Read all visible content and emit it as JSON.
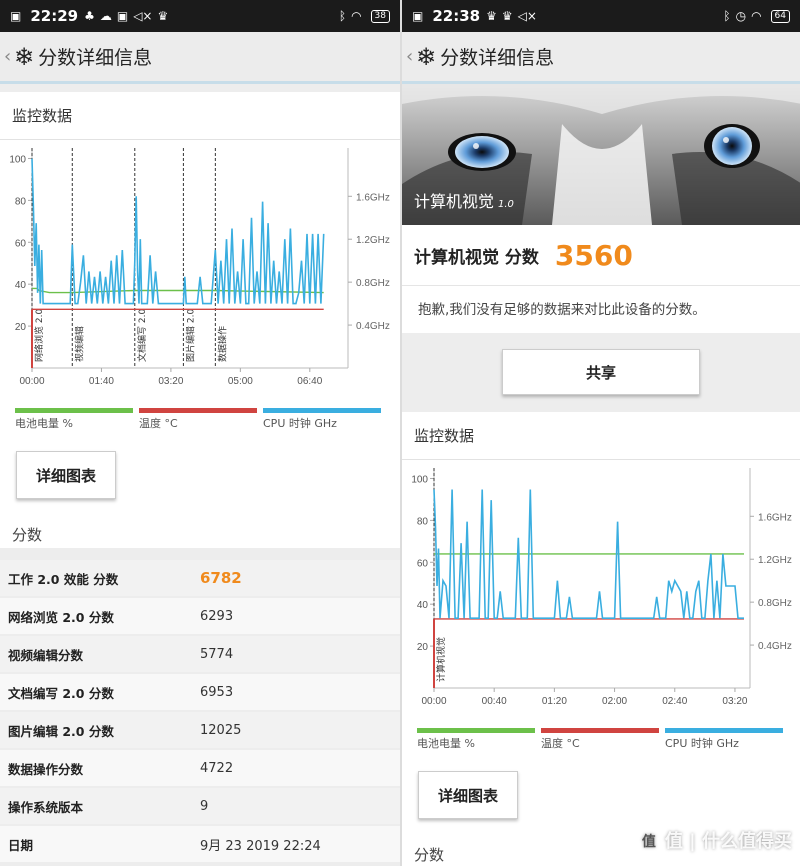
{
  "left": {
    "status": {
      "time": "22:29",
      "icons": [
        "image-icon",
        "penguin-icon",
        "cloud-icon",
        "mute-icon",
        "crown-icon"
      ],
      "battery": "38"
    },
    "header": {
      "title": "分数详细信息",
      "back": "‹",
      "logo": "❄"
    },
    "monitor": {
      "title": "监控数据"
    },
    "chart_labels": {
      "markers": [
        "网络浏览 2.0",
        "视频编辑",
        "文档编写 2.0",
        "图片编辑 2.0",
        "数据操作"
      ]
    },
    "legend": [
      {
        "label": "电池电量 %",
        "color": "#6cc04a"
      },
      {
        "label": "温度 °C",
        "color": "#d04440"
      },
      {
        "label": "CPU 时钟 GHz",
        "color": "#3aaee0"
      }
    ],
    "detail_button": "详细图表",
    "scores_title": "分数",
    "scores": [
      {
        "name": "工作 2.0 效能 分数",
        "value": "6782"
      },
      {
        "name": "网络浏览 2.0 分数",
        "value": "6293"
      },
      {
        "name": "视频编辑分数",
        "value": "5774"
      },
      {
        "name": "文档编写 2.0 分数",
        "value": "6953"
      },
      {
        "name": "图片编辑 2.0 分数",
        "value": "12025"
      },
      {
        "name": "数据操作分数",
        "value": "4722"
      },
      {
        "name": "操作系统版本",
        "value": "9"
      },
      {
        "name": "日期",
        "value": "9月 23 2019 22:24"
      }
    ]
  },
  "right": {
    "status": {
      "time": "22:38",
      "icons": [
        "image-icon",
        "crown-icon",
        "crown-icon",
        "mute-icon"
      ],
      "battery": "64"
    },
    "header": {
      "title": "分数详细信息",
      "back": "‹",
      "logo": "❄"
    },
    "hero": {
      "caption": "计算机视觉",
      "version": "1.0"
    },
    "score": {
      "label": "计算机视觉 分数",
      "value": "3560"
    },
    "notice": "抱歉,我们没有足够的数据来对比此设备的分数。",
    "share_button": "共享",
    "monitor": {
      "title": "监控数据"
    },
    "chart_labels": {
      "markers": [
        "计算机视觉"
      ]
    },
    "legend": [
      {
        "label": "电池电量 %",
        "color": "#6cc04a"
      },
      {
        "label": "温度 °C",
        "color": "#d04440"
      },
      {
        "label": "CPU 时钟 GHz",
        "color": "#3aaee0"
      }
    ],
    "detail_button": "详细图表",
    "scores_title": "分数"
  },
  "watermark": "值 | 什么值得买",
  "chart_data": [
    {
      "type": "line",
      "xlabel": "",
      "ylabel": "",
      "x_ticks": [
        "00:00",
        "01:40",
        "03:20",
        "05:00",
        "06:40"
      ],
      "x_range_minutes": [
        0,
        455
      ],
      "y_ticks_left": [
        20,
        40,
        60,
        80,
        100
      ],
      "ylim_left": [
        0,
        105
      ],
      "y_ticks_right": [
        "0.4GHz",
        "0.8GHz",
        "1.2GHz",
        "1.6GHz"
      ],
      "ylim_right_ghz": [
        0,
        2.05
      ],
      "markers_minutes": [
        0,
        58,
        148,
        218,
        264
      ],
      "series": [
        {
          "name": "电池电量 %",
          "color": "#6cc04a",
          "x": [
            0,
            8,
            10,
            25,
            58,
            148,
            150,
            218,
            264,
            420
          ],
          "y": [
            38,
            38,
            37,
            36,
            36,
            37,
            37,
            37,
            37,
            36
          ]
        },
        {
          "name": "温度 °C",
          "color": "#d04440",
          "x": [
            0,
            420
          ],
          "y": [
            28,
            28
          ]
        },
        {
          "name": "CPU 时钟 GHz",
          "color": "#3aaee0",
          "x": [
            0,
            2,
            4,
            6,
            8,
            10,
            12,
            14,
            16,
            20,
            25,
            30,
            35,
            40,
            45,
            50,
            52,
            55,
            58,
            62,
            66,
            70,
            74,
            78,
            82,
            86,
            90,
            94,
            98,
            102,
            106,
            110,
            114,
            118,
            122,
            126,
            130,
            134,
            138,
            142,
            146,
            148,
            150,
            152,
            154,
            156,
            158,
            162,
            166,
            170,
            174,
            178,
            182,
            186,
            190,
            196,
            202,
            208,
            214,
            218,
            220,
            222,
            226,
            230,
            234,
            238,
            242,
            246,
            250,
            254,
            258,
            264,
            268,
            272,
            276,
            280,
            284,
            288,
            292,
            296,
            300,
            304,
            308,
            312,
            316,
            320,
            324,
            328,
            332,
            336,
            340,
            344,
            348,
            352,
            356,
            360,
            364,
            368,
            372,
            376,
            380,
            384,
            388,
            392,
            396,
            400,
            404,
            408,
            412,
            416,
            420
          ],
          "y": [
            1.95,
            1.5,
            0.95,
            1.35,
            0.7,
            1.15,
            0.6,
            1.1,
            0.6,
            0.6,
            0.6,
            0.6,
            0.6,
            0.6,
            0.6,
            0.6,
            0.6,
            0.6,
            1.15,
            0.6,
            0.6,
            0.8,
            1.05,
            0.6,
            0.9,
            0.6,
            0.85,
            0.6,
            0.9,
            0.6,
            0.85,
            0.6,
            1.0,
            0.6,
            1.05,
            0.6,
            1.1,
            0.6,
            0.6,
            0.6,
            0.6,
            1.0,
            1.6,
            0.9,
            0.6,
            1.2,
            0.6,
            0.6,
            0.6,
            1.05,
            0.6,
            0.9,
            0.6,
            0.6,
            0.6,
            0.6,
            0.6,
            0.6,
            0.6,
            0.6,
            0.85,
            0.6,
            0.6,
            0.6,
            0.6,
            0.6,
            0.85,
            0.6,
            0.6,
            0.6,
            0.6,
            1.1,
            0.6,
            1.0,
            0.6,
            1.2,
            0.6,
            1.3,
            0.6,
            0.9,
            0.6,
            1.2,
            0.6,
            0.6,
            1.4,
            0.6,
            0.9,
            0.6,
            1.55,
            0.6,
            1.35,
            0.6,
            1.0,
            0.6,
            0.9,
            0.6,
            1.2,
            0.6,
            1.3,
            0.6,
            0.6,
            0.7,
            1.0,
            0.6,
            1.25,
            0.6,
            1.25,
            0.6,
            1.25,
            0.6,
            1.25
          ]
        }
      ]
    },
    {
      "type": "line",
      "xlabel": "",
      "ylabel": "",
      "x_ticks": [
        "00:00",
        "00:40",
        "01:20",
        "02:00",
        "02:40",
        "03:20"
      ],
      "x_range_minutes": [
        0,
        210
      ],
      "y_ticks_left": [
        20,
        40,
        60,
        80,
        100
      ],
      "ylim_left": [
        0,
        105
      ],
      "y_ticks_right": [
        "0.4GHz",
        "0.8GHz",
        "1.2GHz",
        "1.6GHz"
      ],
      "ylim_right_ghz": [
        0,
        2.05
      ],
      "markers_minutes": [
        0
      ],
      "series": [
        {
          "name": "电池电量 %",
          "color": "#6cc04a",
          "x": [
            0,
            206
          ],
          "y": [
            64,
            64
          ]
        },
        {
          "name": "温度 °C",
          "color": "#d04440",
          "x": [
            0,
            206
          ],
          "y": [
            33,
            33
          ]
        },
        {
          "name": "CPU 时钟 GHz",
          "color": "#3aaee0",
          "x": [
            0,
            1,
            2,
            3,
            4,
            6,
            8,
            10,
            12,
            14,
            16,
            18,
            20,
            22,
            24,
            26,
            28,
            30,
            32,
            34,
            36,
            38,
            40,
            42,
            44,
            46,
            48,
            50,
            52,
            54,
            56,
            58,
            60,
            62,
            64,
            66,
            68,
            70,
            72,
            74,
            76,
            78,
            80,
            82,
            84,
            86,
            88,
            90,
            92,
            94,
            96,
            98,
            100,
            102,
            104,
            106,
            108,
            110,
            112,
            114,
            116,
            118,
            120,
            122,
            124,
            126,
            128,
            130,
            132,
            134,
            136,
            138,
            140,
            142,
            144,
            146,
            148,
            150,
            152,
            154,
            156,
            158,
            160,
            162,
            164,
            166,
            168,
            170,
            172,
            174,
            176,
            178,
            180,
            182,
            184,
            186,
            188,
            190,
            192,
            194,
            196,
            198,
            200,
            202,
            204,
            206
          ],
          "y": [
            1.85,
            1.5,
            0.95,
            1.3,
            0.65,
            1.0,
            0.95,
            0.65,
            1.85,
            0.65,
            0.65,
            1.35,
            0.65,
            1.55,
            0.65,
            0.65,
            0.65,
            0.65,
            1.85,
            0.65,
            0.65,
            1.75,
            0.65,
            0.65,
            0.9,
            0.65,
            0.65,
            0.65,
            0.65,
            0.65,
            1.4,
            0.65,
            0.65,
            0.65,
            1.85,
            0.65,
            0.65,
            0.65,
            0.65,
            0.65,
            0.65,
            0.65,
            0.65,
            1.0,
            0.65,
            0.65,
            0.65,
            0.85,
            0.65,
            0.65,
            0.65,
            0.65,
            0.65,
            0.65,
            0.65,
            0.65,
            0.65,
            0.9,
            0.65,
            0.65,
            0.65,
            0.65,
            0.65,
            1.55,
            0.65,
            0.65,
            0.65,
            0.65,
            0.65,
            0.65,
            0.65,
            0.65,
            0.65,
            0.65,
            0.65,
            0.65,
            0.85,
            0.65,
            0.65,
            0.65,
            1.0,
            0.9,
            1.0,
            0.95,
            0.9,
            0.65,
            0.9,
            0.65,
            0.65,
            0.9,
            1.0,
            0.65,
            0.65,
            1.0,
            1.25,
            0.65,
            1.0,
            0.65,
            1.25,
            0.95,
            0.95,
            0.95,
            0.95,
            0.65,
            0.65,
            0.65
          ]
        }
      ]
    }
  ]
}
